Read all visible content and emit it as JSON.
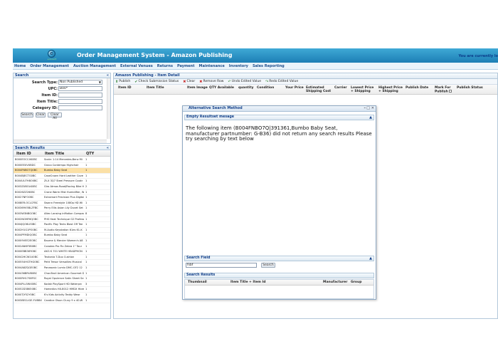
{
  "header": {
    "logo_letter": "e",
    "logo_tagline": "e-bizsoft",
    "title": "Order Management System - Amazon Publishing",
    "user_message": "You are currently lo"
  },
  "nav": [
    "Home",
    "Order Management",
    "Auction Management",
    "External Venues",
    "Returns",
    "Payment",
    "Maintenance",
    "Inventory",
    "Sales Reporting"
  ],
  "search": {
    "title": "Search",
    "collapse_icon": "«",
    "fields": {
      "search_type_label": "Search Type:",
      "search_type_value": "Non Published",
      "upc_label": "UPC:",
      "upc_value": "B00*",
      "item_id_label": "Item ID:",
      "item_id_value": "",
      "item_title_label": "Item Title:",
      "item_title_value": "",
      "category_id_label": "Category ID:",
      "category_id_value": ""
    },
    "buttons": {
      "search": "Search",
      "clear": "Clear",
      "clear_all": "Clear All"
    }
  },
  "search_results": {
    "title": "Search Results",
    "collapse_icon": "«",
    "columns": [
      "Item ID",
      "Item Title",
      "QTY"
    ],
    "selected_index": 2,
    "rows": [
      [
        "B000EOCC4K0BC",
        "Scale: 1:14 Mercedes-Benz Mi",
        "1"
      ],
      [
        "B000EEXVXBDC",
        "Graco Contempo Highchair",
        "1"
      ],
      [
        "B004FNBO7Q0BC",
        "Bumbo Baby Seat",
        "1"
      ],
      [
        "B004BJECTG0BC",
        "CaseCrown Hard Leather Cove",
        "1"
      ],
      [
        "B004UU7H8O0BC",
        "Zt-X 3Q7 Steel Pressure Cookr",
        "1"
      ],
      [
        "B003ZUBOLK0BC",
        "Giro Atmos Road/Racing Bike H",
        "2"
      ],
      [
        "B0026ZZ260BC",
        "Crane Warm Mist Humidifier, W",
        "1"
      ],
      [
        "B0027NFO0BC",
        "Extramart Precision Plus Digital",
        "1"
      ],
      [
        "B008ER-OCLCFBC",
        "Swann Freestyle 1080p HD Wi",
        "1"
      ],
      [
        "B00369V5BLZFBC",
        "Perry Ellis Asian Lily Duvet Set",
        "1"
      ],
      [
        "B003W3NBGOBC",
        "Altec Lansing inMotion Compac",
        "8"
      ],
      [
        "B002NGMF6QOBC",
        "PHS Heat Technique G2 Professi",
        "1"
      ],
      [
        "B004JQO6LE0BC",
        "Pacific Play Tents Blast Off Tee",
        "1"
      ],
      [
        "B002H1G1PO0BC",
        "M-Audio Keystation 61es 61-K",
        "1"
      ],
      [
        "B004PFMDIQOBC",
        "Bumbo Baby Seat",
        "1"
      ],
      [
        "B0009VEE2EOBC",
        "Baume & Mercier Women's A8",
        "1"
      ],
      [
        "B002AN6Y5B0BC",
        "Conolea Pro Fix Zebra 1\" Tour",
        "1"
      ],
      [
        "B000EBB36Y0BC",
        "AKG K 701 WHITE HEADPHON",
        "1"
      ],
      [
        "B0042HCW1U0BC",
        "Teutonia T-Duo Cushion",
        "1"
      ],
      [
        "B0055UHGTHG0BC",
        "Petit Tresor Versailles Musical",
        "1"
      ],
      [
        "B004A8ZQGE0BC",
        "Panasonic Lumix DMC-GF2 12",
        "1"
      ],
      [
        "B00436BRUB0BC",
        "Char-Broil American Gourmet D",
        "1"
      ],
      [
        "B000RH17S8FSC",
        "Royal Opulence Satin Sheet Se",
        "1"
      ],
      [
        "B004PLL5WX0BC",
        "Kodak PlaySport HD Waterprc",
        "3"
      ],
      [
        "B0052D38K50BC",
        "Homedics HX-8012 HMDX Hbre",
        "1"
      ],
      [
        "B000TJY52Y0BC",
        "K's Kids Activity Teddy Wear",
        "1"
      ],
      [
        "B0038ECLIGE-FUBBX",
        "Candice Olson Cluny 9 x 40-W",
        "1"
      ]
    ]
  },
  "main": {
    "panel_title": "Amazon Publishing - Item Detail",
    "toolbar": {
      "publish": "Publish",
      "check_submission_status": "Check Submission Status",
      "clear": "Clear",
      "remove_row": "Remove Row",
      "undo_edited_value": "Undo Edited Value",
      "redo_edited_value": "Redo Edited Value"
    },
    "columns": [
      "Item ID",
      "Item Title",
      "Item Image",
      "QTY Available",
      "quantity",
      "Condition",
      "Your Price",
      "Estimated Shipping Cost",
      "Carrier",
      "Lowest Price + Shipping",
      "Highest Price + Shipping",
      "Publish Date",
      "Mark For Publish",
      "Publish Status"
    ]
  },
  "modal": {
    "title": "Alternative Search Method",
    "controls": {
      "minimize": "–",
      "maximize": "□",
      "close": "✕"
    },
    "empty_section": {
      "title": "Empty Resultset mesage",
      "message": "The following item (B004FNBO7Q|391361,Bumbo Baby Seat, manufacturer partnumber: G-B36) did not return any search results Please try searching by text below"
    },
    "search_field": {
      "title": "Search Field",
      "value": "fsbf",
      "button": "Search"
    },
    "search_results": {
      "title": "Search Results",
      "columns": [
        "Thumbnail",
        "Item Title + Item Id",
        "Manufacturer",
        "Group"
      ]
    }
  },
  "colors": {
    "header_bg": "#1d7fb5",
    "selected_row": "#fbe0a6",
    "panel_title": "#15428b"
  }
}
